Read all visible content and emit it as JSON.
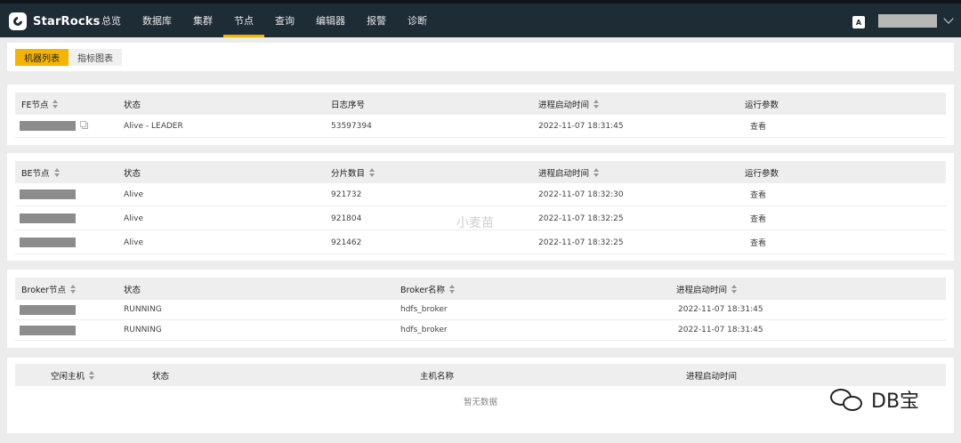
{
  "app": {
    "name": "StarRocks"
  },
  "nav": {
    "items": [
      "总览",
      "数据库",
      "集群",
      "节点",
      "查询",
      "编辑器",
      "报警",
      "诊断"
    ],
    "active_index": 3,
    "lang_icon_label": "A",
    "user_redacted": true
  },
  "tabs": [
    "机器列表",
    "指标图表"
  ],
  "fe_table": {
    "headers": [
      "FE节点",
      "状态",
      "日志序号",
      "进程启动时间",
      "运行参数"
    ],
    "rows": [
      {
        "status": "Alive - LEADER",
        "journal": "53597394",
        "start_time": "2022-11-07 18:31:45",
        "params": "查看"
      }
    ]
  },
  "be_table": {
    "headers": [
      "BE节点",
      "状态",
      "分片数目",
      "进程启动时间",
      "运行参数"
    ],
    "rows": [
      {
        "status": "Alive",
        "tablets": "921732",
        "start_time": "2022-11-07 18:32:30",
        "params": "查看"
      },
      {
        "status": "Alive",
        "tablets": "921804",
        "start_time": "2022-11-07 18:32:25",
        "params": "查看"
      },
      {
        "status": "Alive",
        "tablets": "921462",
        "start_time": "2022-11-07 18:32:25",
        "params": "查看"
      }
    ]
  },
  "broker_table": {
    "headers": [
      "Broker节点",
      "状态",
      "Broker名称",
      "进程启动时间"
    ],
    "rows": [
      {
        "status": "RUNNING",
        "name": "hdfs_broker",
        "start_time": "2022-11-07 18:31:45"
      },
      {
        "status": "RUNNING",
        "name": "hdfs_broker",
        "start_time": "2022-11-07 18:31:45"
      }
    ]
  },
  "idle_table": {
    "headers": [
      "空闲主机",
      "状态",
      "主机名称",
      "进程启动时间"
    ],
    "empty_text": "暂无数据"
  },
  "watermarks": {
    "center": "小麦苗",
    "brand": "DB宝"
  }
}
